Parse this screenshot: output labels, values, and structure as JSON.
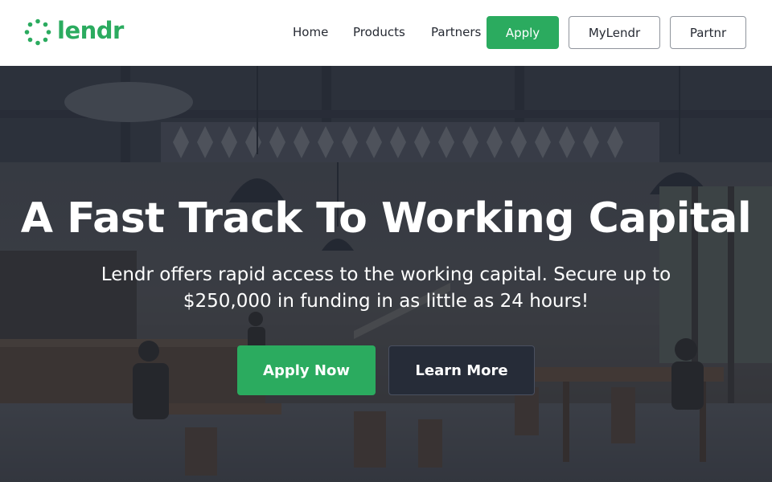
{
  "brand": {
    "name": "lendr",
    "color": "#2bab5f"
  },
  "nav": {
    "links": [
      "Home",
      "Products",
      "Partners"
    ],
    "apply_label": "Apply",
    "mylendr_label": "MyLendr",
    "partnr_label": "Partnr"
  },
  "hero": {
    "title": "A Fast Track To Working Capital",
    "subtitle": "Lendr offers rapid access to the working capital. Secure up to $250,000 in funding in as little as 24 hours!",
    "primary_cta": "Apply Now",
    "secondary_cta": "Learn More",
    "overlay_color": "#2b313c"
  }
}
